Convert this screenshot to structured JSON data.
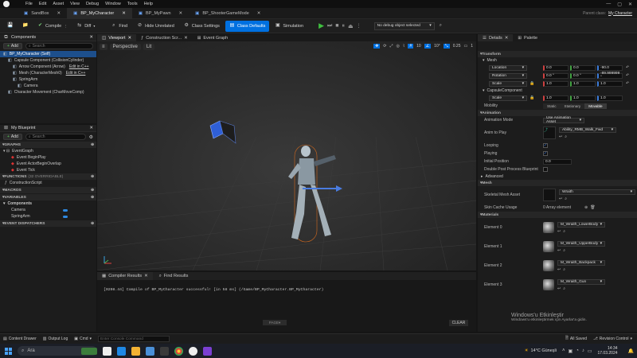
{
  "menu": [
    "File",
    "Edit",
    "Asset",
    "View",
    "Debug",
    "Window",
    "Tools",
    "Help"
  ],
  "tabs": [
    {
      "label": "SandBox",
      "active": false
    },
    {
      "label": "BP_MyCharacter",
      "active": true
    },
    {
      "label": "BP_MyPawn",
      "active": false
    },
    {
      "label": "BP_ShooterGameMode",
      "active": false
    }
  ],
  "parent_class_label": "Parent class:",
  "parent_class_value": "My Character",
  "toolbar": {
    "compile": "Compile",
    "diff": "Diff",
    "find": "Find",
    "hide_unrelated": "Hide Unrelated",
    "class_settings": "Class Settings",
    "class_defaults": "Class Defaults",
    "simulation": "Simulation",
    "debug_select": "No debug object selected"
  },
  "components": {
    "title": "Components",
    "add": "Add",
    "search_placeholder": "Search",
    "items": [
      {
        "label": "BP_MyCharacter (Self)",
        "indent": 0,
        "selected": true
      },
      {
        "label": "Capsule Component (CollisionCylinder)",
        "indent": 1
      },
      {
        "label": "Arrow Component (Arrow)",
        "indent": 2,
        "link": "Edit in C++"
      },
      {
        "label": "Mesh (CharacterMesh0)",
        "indent": 2,
        "link": "Edit in C++"
      },
      {
        "label": "SpringArm",
        "indent": 2
      },
      {
        "label": "Camera",
        "indent": 3
      },
      {
        "label": "Character Movement (CharMoveComp)",
        "indent": 1
      }
    ]
  },
  "blueprint": {
    "title": "My Blueprint",
    "add": "Add",
    "search_placeholder": "Search",
    "graphs_label": "GRAPHS",
    "event_graph": "EventGraph",
    "events": [
      "Event BeginPlay",
      "Event ActorBeginOverlap",
      "Event Tick"
    ],
    "functions_label": "FUNCTIONS",
    "functions_note": "(32 OVERRIDABLE)",
    "functions": [
      "ConstructionScript"
    ],
    "macros_label": "MACROS",
    "variables_label": "VARIABLES",
    "components_group": "Components",
    "variables": [
      "Camera",
      "SpringArm"
    ],
    "dispatchers_label": "EVENT DISPATCHERS"
  },
  "viewport_tabs": [
    "Viewport",
    "Construction Scr...",
    "Event Graph"
  ],
  "viewport": {
    "perspective": "Perspective",
    "lit": "Lit",
    "grid": "10",
    "angle": "10°",
    "scale": "0.25",
    "cam": "1"
  },
  "compiler": {
    "tab1": "Compiler Results",
    "tab2": "Find Results",
    "message": "[0208.44] Compile of BP_MyCharacter successful! [in 58 ms] (/Game/BP_MyCharacter.BP_MyCharacter)",
    "page": "PAGE",
    "clear": "CLEAR"
  },
  "details": {
    "tab1": "Details",
    "tab2": "Palette",
    "transform": "Transform",
    "mesh_label": "Mesh",
    "location": "Location",
    "rotation": "Rotation",
    "scale": "Scale",
    "loc": [
      "0.0",
      "0.0",
      "-90.0"
    ],
    "rot": [
      "0.0 °",
      "0.0 °",
      "-89.999999 °"
    ],
    "scl": [
      "1.0",
      "1.0",
      "1.0"
    ],
    "capsule": "CapsuleComponent",
    "cap_scale": [
      "1.0",
      "1.0",
      "1.0"
    ],
    "mobility": "Mobility",
    "mob": [
      "Static",
      "Stationary",
      "Movable"
    ],
    "animation": "Animation",
    "anim_mode_label": "Animation Mode",
    "anim_mode": "Use Animation Asset",
    "anim_play_label": "Anim to Play",
    "anim_asset": "Ability_RMB_Walk_Fwd",
    "looping": "Looping",
    "playing": "Playing",
    "initial_position": "Initial Position",
    "initial_value": "0.0",
    "double_post": "Double Post Process Blueprint",
    "advanced": "Advanced",
    "mesh_section": "Mesh",
    "skel_label": "Skeletal Mesh Asset",
    "skel_value": "Wraith",
    "skin_cache": "Skin Cache Usage",
    "skin_value": "0 Array element",
    "materials": "Materials",
    "elements": [
      {
        "label": "Element 0",
        "mat": "M_Wraith_LowerBody"
      },
      {
        "label": "Element 1",
        "mat": "M_Wraith_UpperBody"
      },
      {
        "label": "Element 2",
        "mat": "M_Wraith_Backpack"
      },
      {
        "label": "Element 3",
        "mat": "M_Wraith_Gun"
      }
    ]
  },
  "watermark": {
    "line1": "Windows'u Etkinleştir",
    "line2": "Windows'u etkinleştirmek için Ayarlar'a gidin."
  },
  "status": {
    "content_drawer": "Content Drawer",
    "output_log": "Output Log",
    "cmd": "Cmd",
    "console_placeholder": "Enter Console Command",
    "all_saved": "All Saved",
    "revision": "Revision Control"
  },
  "taskbar": {
    "search": "Ara",
    "weather": "14°C  Güneşli",
    "time": "14:34",
    "date": "17.03.2024"
  }
}
